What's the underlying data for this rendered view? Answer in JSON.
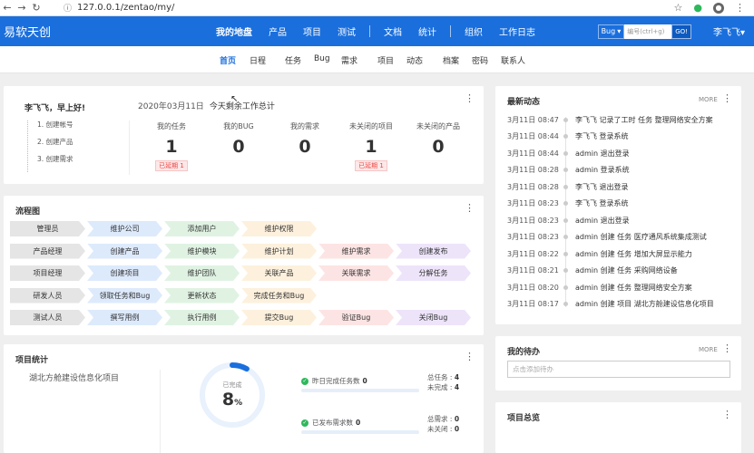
{
  "browser": {
    "url": "127.0.0.1/zentao/my/"
  },
  "header": {
    "logo": "易软天创",
    "nav": [
      "我的地盘",
      "产品",
      "项目",
      "测试",
      "文档",
      "统计",
      "组织",
      "工作日志"
    ],
    "search_type": "Bug",
    "search_placeholder": "编号(ctrl+g)",
    "go_label": "GO!",
    "user": "李飞飞"
  },
  "subnav": [
    "首页",
    "日程",
    "任务",
    "Bug",
    "需求",
    "项目",
    "动态",
    "档案",
    "密码",
    "联系人"
  ],
  "welcome": {
    "greeting": "李飞飞，早上好!",
    "steps": [
      "1. 创建帐号",
      "2. 创建产品",
      "3. 创建需求"
    ],
    "date": "2020年03月11日",
    "summary": "今天剩余工作总计",
    "stats": [
      {
        "label": "我的任务",
        "value": "1",
        "tag": "已延期 1"
      },
      {
        "label": "我的BUG",
        "value": "0",
        "tag": ""
      },
      {
        "label": "我的需求",
        "value": "0",
        "tag": ""
      },
      {
        "label": "未关闭的项目",
        "value": "1",
        "tag": "已延期 1"
      },
      {
        "label": "未关闭的产品",
        "value": "0",
        "tag": ""
      }
    ]
  },
  "flow": {
    "title": "流程图",
    "rows": [
      [
        "管理员",
        "维护公司",
        "添加用户",
        "维护权限"
      ],
      [
        "产品经理",
        "创建产品",
        "维护模块",
        "维护计划",
        "维护需求",
        "创建发布"
      ],
      [
        "项目经理",
        "创建项目",
        "维护团队",
        "关联产品",
        "关联需求",
        "分解任务"
      ],
      [
        "研发人员",
        "领取任务和Bug",
        "更新状态",
        "完成任务和Bug"
      ],
      [
        "测试人员",
        "撰写用例",
        "执行用例",
        "提交Bug",
        "验证Bug",
        "关闭Bug"
      ]
    ],
    "colors": [
      "#e5e5e5",
      "#ddeafc",
      "#e0f3e3",
      "#fdf1dd",
      "#fde4e4",
      "#ede4fa"
    ]
  },
  "feed": {
    "title": "最新动态",
    "more": "MORE",
    "items": [
      {
        "time": "3月11日 08:47",
        "text": "李飞飞 记录了工时 任务 整理网络安全方案"
      },
      {
        "time": "3月11日 08:44",
        "text": "李飞飞 登录系统"
      },
      {
        "time": "3月11日 08:44",
        "text": "admin 退出登录"
      },
      {
        "time": "3月11日 08:28",
        "text": "admin 登录系统"
      },
      {
        "time": "3月11日 08:28",
        "text": "李飞飞 退出登录"
      },
      {
        "time": "3月11日 08:23",
        "text": "李飞飞 登录系统"
      },
      {
        "time": "3月11日 08:23",
        "text": "admin 退出登录"
      },
      {
        "time": "3月11日 08:23",
        "text": "admin 创建 任务 医疗通风系统集成测试"
      },
      {
        "time": "3月11日 08:22",
        "text": "admin 创建 任务 增加大屏显示能力"
      },
      {
        "time": "3月11日 08:21",
        "text": "admin 创建 任务 采购网络设备"
      },
      {
        "time": "3月11日 08:20",
        "text": "admin 创建 任务 整理网络安全方案"
      },
      {
        "time": "3月11日 08:17",
        "text": "admin 创建 项目 湖北方舱建设信息化项目"
      }
    ]
  },
  "todo": {
    "title": "我的待办",
    "more": "MORE",
    "placeholder": "点击添加待办"
  },
  "project_stats": {
    "title": "项目统计",
    "project_name": "湖北方舱建设信息化项目",
    "ring_label": "已完成",
    "progress": "8",
    "progress_unit": "%",
    "progress_fraction": 0.08,
    "line1_label": "昨日完成任务数",
    "line1_value": "0",
    "line2_label": "已发布需求数",
    "line2_value": "0",
    "total_tasks_label": "总任务 :",
    "total_tasks": "4",
    "unfinished_label": "未完成 :",
    "unfinished": "4",
    "total_req_label": "总需求 :",
    "total_req": "0",
    "closed_label": "未关闭 :",
    "closed": "0"
  },
  "project_overview": {
    "title": "项目总览"
  }
}
